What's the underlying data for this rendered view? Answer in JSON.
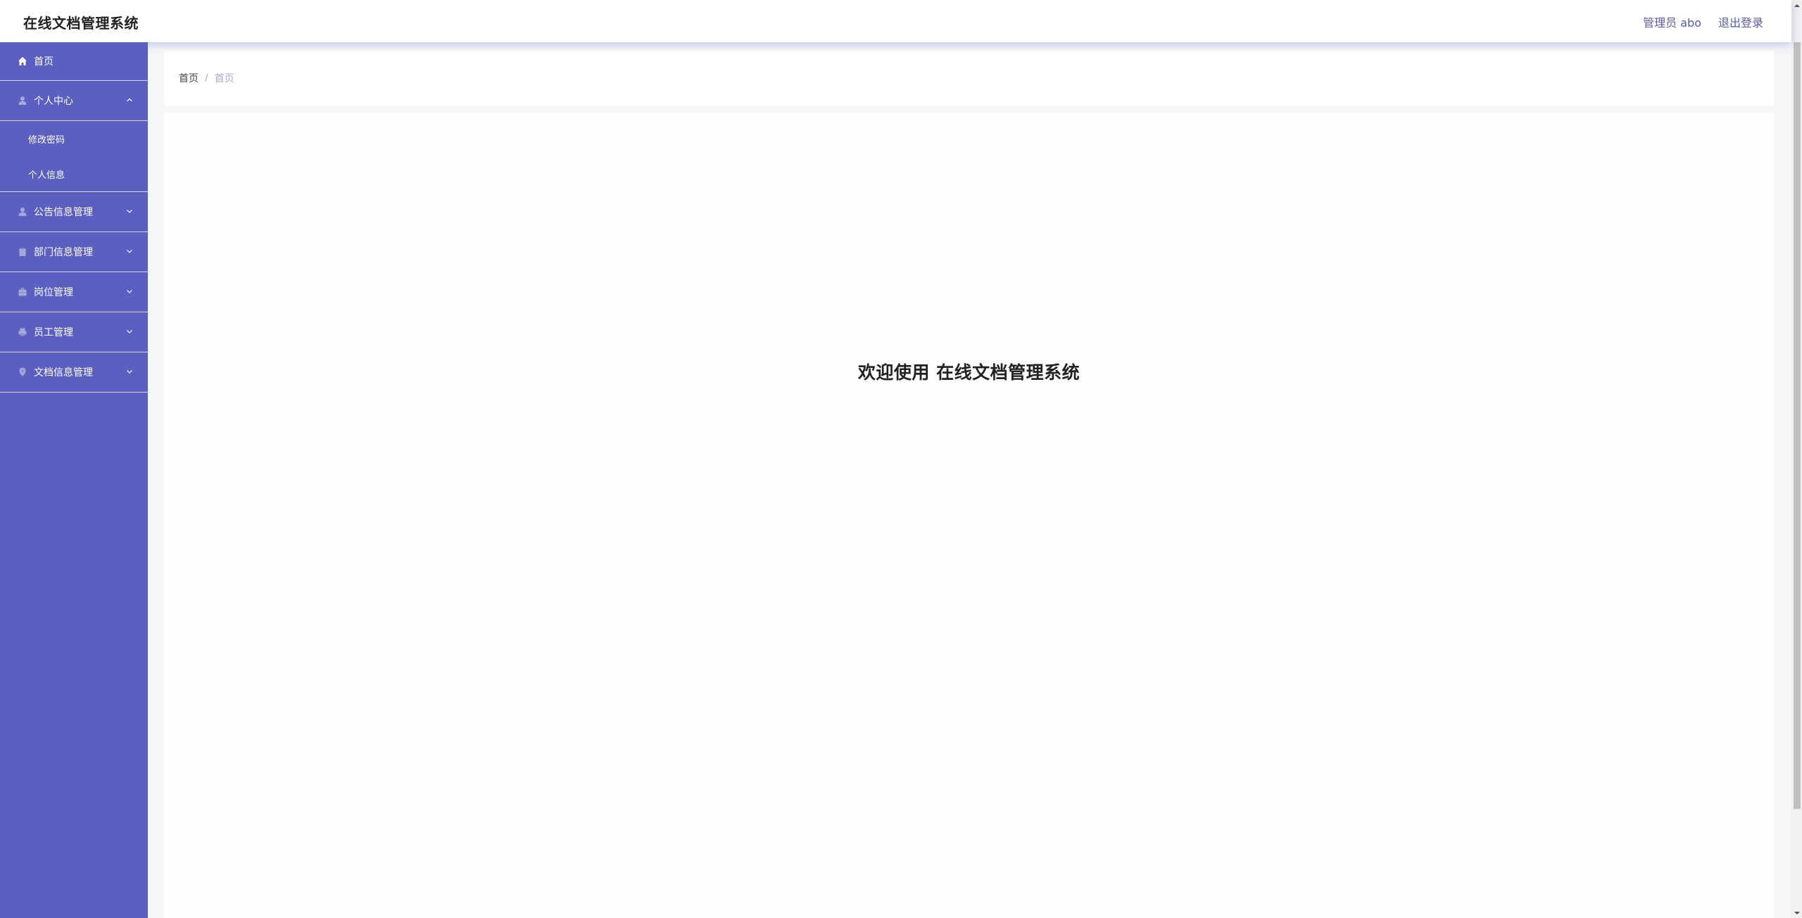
{
  "header": {
    "app_title": "在线文档管理系统",
    "user_label": "管理员 abo",
    "logout_label": "退出登录"
  },
  "sidebar": {
    "items": [
      {
        "label": "首页",
        "icon": "home-icon"
      },
      {
        "label": "个人中心",
        "icon": "user-icon",
        "expanded": true,
        "children": [
          {
            "label": "修改密码"
          },
          {
            "label": "个人信息"
          }
        ]
      },
      {
        "label": "公告信息管理",
        "icon": "user-icon"
      },
      {
        "label": "部门信息管理",
        "icon": "clipboard-icon"
      },
      {
        "label": "岗位管理",
        "icon": "briefcase-icon"
      },
      {
        "label": "员工管理",
        "icon": "printer-icon"
      },
      {
        "label": "文档信息管理",
        "icon": "location-pin-icon"
      }
    ]
  },
  "breadcrumb": {
    "home": "首页",
    "separator": "/",
    "current": "首页"
  },
  "main": {
    "welcome": "欢迎使用 在线文档管理系统"
  },
  "colors": {
    "sidebar_bg": "#5b5fc0",
    "accent": "#5a5aa8"
  }
}
